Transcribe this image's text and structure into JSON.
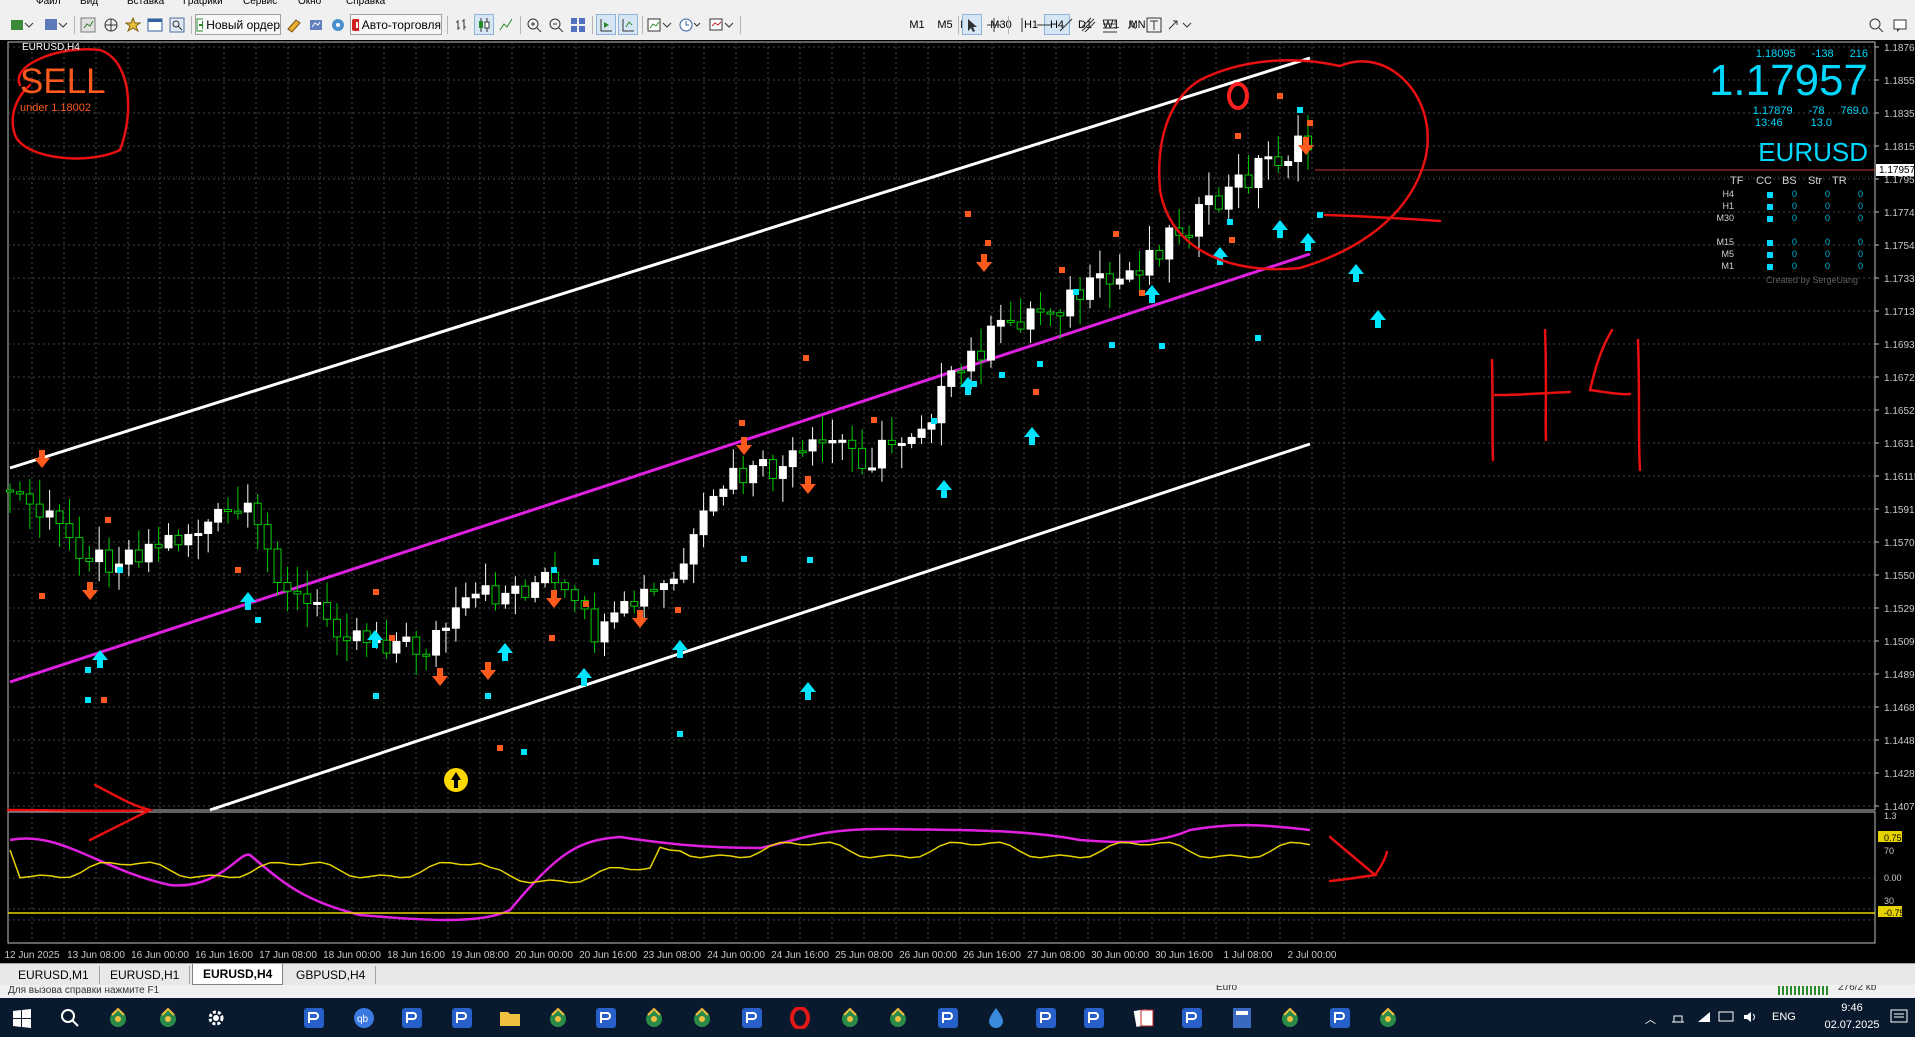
{
  "menu": {
    "items": [
      "Файл",
      "Вид",
      "Вставка",
      "Графики",
      "Сервис",
      "Окно",
      "Справка"
    ]
  },
  "toolbar": {
    "new_order": "Новый ордер",
    "auto_trading": "Авто-торговля",
    "timeframes": [
      "M1",
      "M5",
      "M15",
      "M30",
      "H1",
      "H4",
      "D1",
      "W1",
      "MN"
    ],
    "active_timeframe": "H4"
  },
  "chart": {
    "window_title": "EURUSD,H4",
    "signal": {
      "label": "SELL",
      "sub": "under 1.18002"
    },
    "handwriting": "H4",
    "price_axis": [
      "1.18760",
      "1.18555",
      "1.18350",
      "1.18150",
      "1.17957",
      "1.17745",
      "1.17540",
      "1.17335",
      "1.17130",
      "1.16930",
      "1.16725",
      "1.16520",
      "1.16315",
      "1.16115",
      "1.15910",
      "1.15705",
      "1.15500",
      "1.15295",
      "1.15095",
      "1.14890",
      "1.14685",
      "1.14480",
      "1.14280",
      "1.14075"
    ],
    "current_price_tag": "1.17957",
    "time_axis": [
      "12 Jun 2025",
      "13 Jun 08:00",
      "16 Jun 00:00",
      "16 Jun 16:00",
      "17 Jun 08:00",
      "18 Jun 00:00",
      "18 Jun 16:00",
      "19 Jun 08:00",
      "20 Jun 00:00",
      "20 Jun 16:00",
      "23 Jun 08:00",
      "24 Jun 00:00",
      "24 Jun 16:00",
      "25 Jun 08:00",
      "26 Jun 00:00",
      "26 Jun 16:00",
      "27 Jun 08:00",
      "30 Jun 00:00",
      "30 Jun 16:00",
      "1 Jul 08:00",
      "2 Jul 00:00"
    ],
    "info_panel": {
      "high": "1.18095",
      "high_pts": "-138",
      "high_val": "216",
      "price": "1.17957",
      "low": "1.17879",
      "low_pts": "-78",
      "low_val": "769.0",
      "time": "13:46",
      "time_val": "13.0",
      "symbol": "EURUSD",
      "headers": [
        "TF",
        "CC",
        "BS",
        "Str",
        "TR"
      ],
      "rows": [
        {
          "tf": "H4",
          "v": [
            "0",
            "0",
            "0"
          ]
        },
        {
          "tf": "H1",
          "v": [
            "0",
            "0",
            "0"
          ]
        },
        {
          "tf": "M30",
          "v": [
            "0",
            "0",
            "0"
          ]
        },
        {
          "tf": "M15",
          "v": [
            "0",
            "0",
            "0"
          ]
        },
        {
          "tf": "M5",
          "v": [
            "0",
            "0",
            "0"
          ]
        },
        {
          "tf": "M1",
          "v": [
            "0",
            "0",
            "0"
          ]
        }
      ],
      "credit": "Created by SergeUang"
    },
    "oscillator_axis": [
      "1.3",
      "0.75",
      "70",
      "0.00",
      "30",
      "-0.75"
    ]
  },
  "tabs": [
    {
      "label": "EURUSD,M1",
      "active": false
    },
    {
      "label": "EURUSD,H1",
      "active": false
    },
    {
      "label": "EURUSD,H4",
      "active": true
    },
    {
      "label": "GBPUSD,H4",
      "active": false
    }
  ],
  "status": {
    "help": "Для вызова справки нажмите F1",
    "profile": "Euro",
    "traffic": "276/2 kb"
  },
  "taskbar": {
    "lang": "ENG",
    "time": "9:46",
    "date": "02.07.2025"
  },
  "colors": {
    "bg": "#000000",
    "grid": "#5a5a5a",
    "bull": "#ffffff",
    "bear": "#00cc00",
    "magenta": "#e020e0",
    "cyan": "#00e5ff",
    "orange": "#ff5a1e",
    "annotation": "#e81010",
    "yellow": "#ffff00"
  }
}
